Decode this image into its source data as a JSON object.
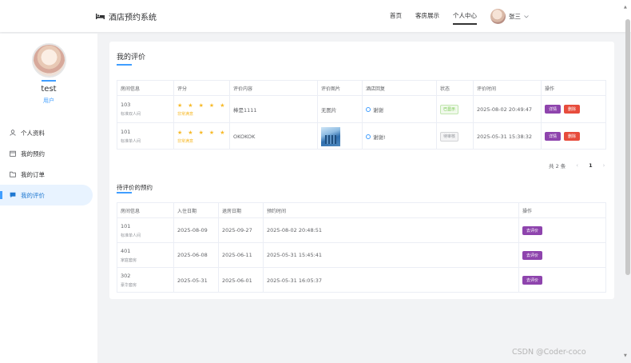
{
  "header": {
    "brand": "酒店预约系统",
    "nav": [
      "首页",
      "客房展示",
      "个人中心"
    ],
    "active_nav": "个人中心",
    "user_name": "张三"
  },
  "sidebar": {
    "profile_name": "test",
    "profile_role": "用户",
    "items": [
      {
        "label": "个人资料",
        "icon": "user-icon"
      },
      {
        "label": "我的预约",
        "icon": "calendar-icon"
      },
      {
        "label": "我的订单",
        "icon": "folder-icon"
      },
      {
        "label": "我的评价",
        "icon": "comment-icon"
      }
    ],
    "active_item": "我的评价"
  },
  "reviews": {
    "title": "我的评价",
    "columns": [
      "房间信息",
      "评分",
      "评价内容",
      "评价图片",
      "酒店回复",
      "状态",
      "评价时间",
      "操作"
    ],
    "rows": [
      {
        "room_no": "103",
        "room_type": "标准双人间",
        "stars": "★ ★ ★ ★ ★",
        "rating_text": "非常满意",
        "content": "棒是1111",
        "image": "无图片",
        "reply": "谢谢",
        "status": "已显示",
        "time": "2025-08-02 20:49:47",
        "detail": "详情",
        "delete": "删除"
      },
      {
        "room_no": "101",
        "room_type": "标准单人间",
        "stars": "★ ★ ★ ★ ★",
        "rating_text": "非常满意",
        "content": "OKOKOK",
        "image": "",
        "reply": "谢谢!",
        "status": "待审核",
        "time": "2025-05-31 15:38:32",
        "detail": "详情",
        "delete": "删除"
      }
    ],
    "pager": {
      "total": "共 2 条",
      "page": "1"
    }
  },
  "pending": {
    "title": "待评价的预约",
    "columns": [
      "房间信息",
      "入住日期",
      "退房日期",
      "预约时间",
      "操作"
    ],
    "rows": [
      {
        "room_no": "101",
        "room_type": "标准单人间",
        "checkin": "2025-08-09",
        "checkout": "2025-09-27",
        "booked": "2025-08-02 20:48:51",
        "action": "去评价"
      },
      {
        "room_no": "401",
        "room_type": "家庭套房",
        "checkin": "2025-06-08",
        "checkout": "2025-06-11",
        "booked": "2025-05-31 15:45:41",
        "action": "去评价"
      },
      {
        "room_no": "302",
        "room_type": "豪华套房",
        "checkin": "2025-05-31",
        "checkout": "2025-06-01",
        "booked": "2025-05-31 16:05:37",
        "action": "去评价"
      }
    ]
  },
  "watermark": "CSDN @Coder-coco"
}
